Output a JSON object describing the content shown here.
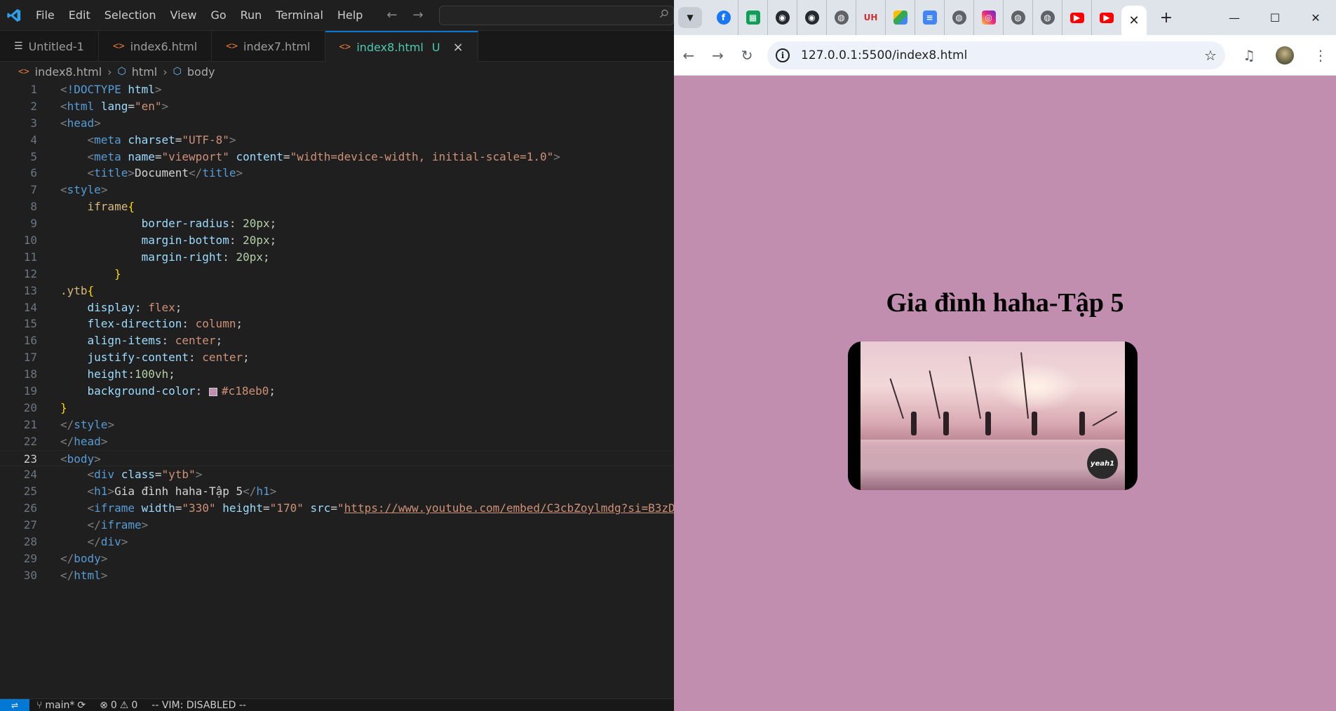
{
  "vscode": {
    "menu": [
      "File",
      "Edit",
      "Selection",
      "View",
      "Go",
      "Run",
      "Terminal",
      "Help"
    ],
    "tabs": [
      {
        "label": "Untitled-1",
        "active": false
      },
      {
        "label": "index6.html",
        "active": false
      },
      {
        "label": "index7.html",
        "active": false
      },
      {
        "label": "index8.html",
        "active": true,
        "status": "U"
      }
    ],
    "breadcrumb": [
      "index8.html",
      "html",
      "body"
    ],
    "current_line": 23,
    "statusbar": {
      "branch": "main*",
      "errors": "0",
      "warnings": "0",
      "vim": "-- VIM: DISABLED --"
    },
    "swatch_color": "#c18eb0"
  },
  "chrome": {
    "url": "127.0.0.1:5500/index8.html",
    "favicons": [
      "facebook",
      "google-sheets",
      "github",
      "github",
      "globe",
      "hcmute",
      "google-drive",
      "google-docs",
      "globe",
      "instagram",
      "globe",
      "globe",
      "youtube",
      "youtube"
    ],
    "page": {
      "heading": "Gia đình haha-Tập 5",
      "background": "#c18eb0",
      "video_badge": "yeah1"
    }
  }
}
